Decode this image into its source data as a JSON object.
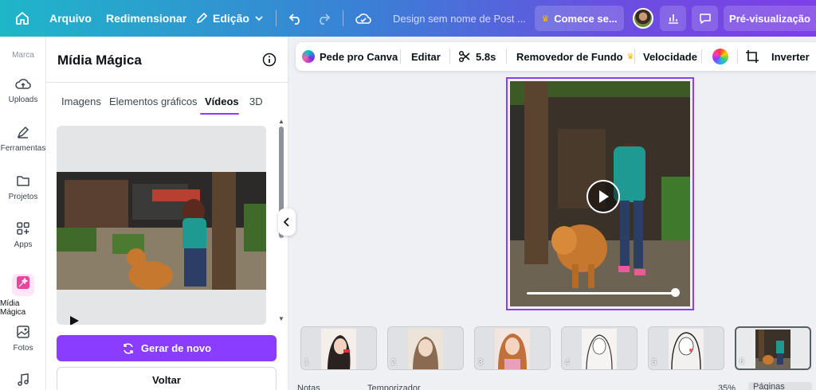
{
  "topbar": {
    "file_label": "Arquivo",
    "resize_label": "Redimensionar",
    "edit_label": "Edição",
    "doc_title": "Design sem nome de Post ...",
    "pro_label": "Comece se...",
    "preview_label": "Pré-visualização"
  },
  "rail": {
    "brand": "Marca",
    "items": [
      {
        "label": "Uploads",
        "icon": "cloud-upload-icon"
      },
      {
        "label": "Ferramentas",
        "icon": "pen-tool-icon"
      },
      {
        "label": "Projetos",
        "icon": "folder-icon"
      },
      {
        "label": "Apps",
        "icon": "apps-icon"
      },
      {
        "label": "Mídia Mágica",
        "icon": "magic-media-icon"
      },
      {
        "label": "Fotos",
        "icon": "photo-icon"
      },
      {
        "label": "",
        "icon": "music-icon"
      }
    ]
  },
  "panel": {
    "title": "Mídia Mágica",
    "tabs": [
      {
        "label": "Imagens"
      },
      {
        "label": "Elementos gráficos"
      },
      {
        "label": "Vídeos"
      },
      {
        "label": "3D"
      }
    ],
    "generate_again": "Gerar de novo",
    "back": "Voltar"
  },
  "toolbar": {
    "ask_canva": "Pede pro Canva",
    "edit": "Editar",
    "duration": "5.8s",
    "bg_remover": "Removedor de Fundo",
    "speed": "Velocidade",
    "flip": "Inverter"
  },
  "timeline": {
    "pages": [
      "1",
      "2",
      "3",
      "4",
      "5",
      "6"
    ]
  },
  "bottom": {
    "notes": "Notas",
    "timer": "Temporizador",
    "zoom": "35%",
    "pages": "Páginas"
  },
  "colors": {
    "accent": "#8b3dff",
    "topbar_start": "#1fb6c9",
    "topbar_end": "#7d3fe6"
  }
}
